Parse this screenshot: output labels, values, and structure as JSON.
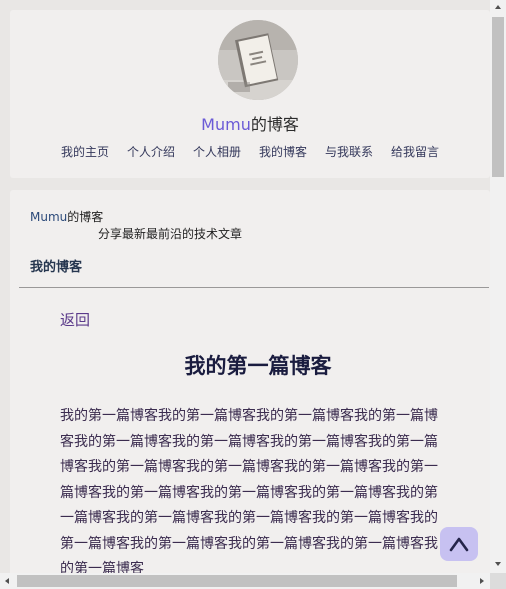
{
  "header": {
    "brand": "Mumu",
    "title_suffix": "的博客",
    "nav": [
      {
        "label": "我的主页"
      },
      {
        "label": "个人介绍"
      },
      {
        "label": "个人相册"
      },
      {
        "label": "我的博客"
      },
      {
        "label": "与我联系"
      },
      {
        "label": "给我留言"
      }
    ]
  },
  "page": {
    "crumb_brand": "Mumu",
    "crumb_suffix": "的博客",
    "slogan": "分享最新最前沿的技术文章",
    "section_label": "我的博客"
  },
  "article": {
    "back_label": "返回",
    "title": "我的第一篇博客",
    "body": "我的第一篇博客我的第一篇博客我的第一篇博客我的第一篇博客我的第一篇博客我的第一篇博客我的第一篇博客我的第一篇博客我的第一篇博客我的第一篇博客我的第一篇博客我的第一篇博客我的第一篇博客我的第一篇博客我的第一篇博客我的第一篇博客我的第一篇博客我的第一篇博客我的第一篇博客我的第一篇博客我的第一篇博客我的第一篇博客我的第一篇博客我的第一篇博客"
  },
  "back_to_top": {
    "icon": "chevron-up-icon"
  },
  "colors": {
    "accent": "#6b5bd6",
    "back_to_top_bg": "#c7c1f1",
    "card_bg": "#f1efee",
    "page_bg": "#e9e7e5"
  }
}
